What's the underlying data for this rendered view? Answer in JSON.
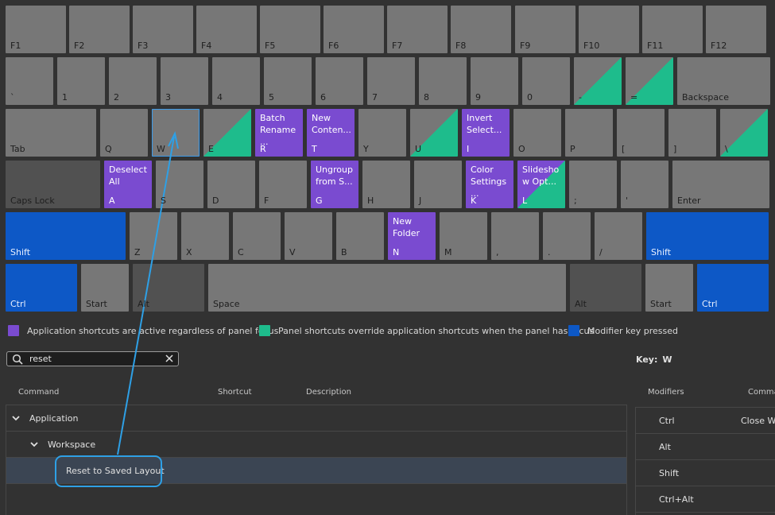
{
  "keyboard": {
    "row1": [
      {
        "key": "F1",
        "cmd": ""
      },
      {
        "key": "F2",
        "cmd": ""
      },
      {
        "key": "F3",
        "cmd": ""
      },
      {
        "key": "F4",
        "cmd": ""
      },
      {
        "key": "F5",
        "cmd": ""
      },
      {
        "key": "F6",
        "cmd": ""
      },
      {
        "key": "F7",
        "cmd": ""
      },
      {
        "key": "F8",
        "cmd": ""
      },
      {
        "key": "F9",
        "cmd": ""
      },
      {
        "key": "F10",
        "cmd": ""
      },
      {
        "key": "F11",
        "cmd": ""
      },
      {
        "key": "F12",
        "cmd": ""
      }
    ],
    "row2": [
      {
        "key": "`"
      },
      {
        "key": "1"
      },
      {
        "key": "2"
      },
      {
        "key": "3"
      },
      {
        "key": "4"
      },
      {
        "key": "5"
      },
      {
        "key": "6"
      },
      {
        "key": "7"
      },
      {
        "key": "8"
      },
      {
        "key": "9"
      },
      {
        "key": "0"
      },
      {
        "key": "-"
      },
      {
        "key": "="
      },
      {
        "key": "Backspace"
      }
    ],
    "row3": [
      {
        "key": "Tab",
        "cmd": ""
      },
      {
        "key": "Q",
        "cmd": ""
      },
      {
        "key": "W",
        "cmd": ""
      },
      {
        "key": "E",
        "cmd": ""
      },
      {
        "key": "R",
        "cmd": "Batch Rename ..."
      },
      {
        "key": "T",
        "cmd": "New Conten..."
      },
      {
        "key": "Y",
        "cmd": ""
      },
      {
        "key": "U",
        "cmd": ""
      },
      {
        "key": "I",
        "cmd": "Invert Select..."
      },
      {
        "key": "O",
        "cmd": ""
      },
      {
        "key": "P",
        "cmd": ""
      },
      {
        "key": "[",
        "cmd": ""
      },
      {
        "key": "]",
        "cmd": ""
      },
      {
        "key": "\\",
        "cmd": ""
      }
    ],
    "row4": [
      {
        "key": "Caps Lock",
        "cmd": ""
      },
      {
        "key": "A",
        "cmd": "Deselect All"
      },
      {
        "key": "S",
        "cmd": ""
      },
      {
        "key": "D",
        "cmd": ""
      },
      {
        "key": "F",
        "cmd": ""
      },
      {
        "key": "G",
        "cmd": "Ungroup from S..."
      },
      {
        "key": "H",
        "cmd": ""
      },
      {
        "key": "J",
        "cmd": ""
      },
      {
        "key": "K",
        "cmd": "Color Settings ..."
      },
      {
        "key": "L",
        "cmd": "Slidesho w Opt..."
      },
      {
        "key": ";",
        "cmd": ""
      },
      {
        "key": "'",
        "cmd": ""
      },
      {
        "key": "Enter",
        "cmd": ""
      }
    ],
    "row5": [
      {
        "key": "Shift",
        "cmd": ""
      },
      {
        "key": "Z",
        "cmd": ""
      },
      {
        "key": "X",
        "cmd": ""
      },
      {
        "key": "C",
        "cmd": ""
      },
      {
        "key": "V",
        "cmd": ""
      },
      {
        "key": "B",
        "cmd": ""
      },
      {
        "key": "N",
        "cmd": "New Folder"
      },
      {
        "key": "M",
        "cmd": ""
      },
      {
        "key": ",",
        "cmd": ""
      },
      {
        "key": ".",
        "cmd": ""
      },
      {
        "key": "/",
        "cmd": ""
      },
      {
        "key": "Shift",
        "cmd": ""
      }
    ],
    "row6": [
      {
        "key": "Ctrl"
      },
      {
        "key": "Start"
      },
      {
        "key": "Alt"
      },
      {
        "key": "Space"
      },
      {
        "key": "Alt"
      },
      {
        "key": "Start"
      },
      {
        "key": "Ctrl"
      }
    ]
  },
  "legend": {
    "application": "Application shortcuts are active regardless of panel focus",
    "panel": "Panel shortcuts override application shortcuts when the panel has focus",
    "modifier": "Modifier key pressed",
    "colors": {
      "application": "#7a4bd0",
      "panel": "#1ebc8c",
      "modifier": "#0d58c6"
    }
  },
  "search": {
    "value": "reset",
    "icon": "search-icon",
    "clear_icon": "close-icon"
  },
  "key_info": {
    "label": "Key:",
    "value": "W"
  },
  "command_table": {
    "headers": {
      "command": "Command",
      "shortcut": "Shortcut",
      "description": "Description"
    },
    "rows": [
      {
        "label": "Application",
        "level": 0,
        "expanded": true
      },
      {
        "label": "Workspace",
        "level": 1,
        "expanded": true
      },
      {
        "label": "Reset to Saved Layout",
        "level": 2,
        "selected": true
      }
    ]
  },
  "modifier_table": {
    "headers": {
      "modifiers": "Modifiers",
      "command": "Comma"
    },
    "rows": [
      {
        "modifier": "Ctrl",
        "command": "Close Wi"
      },
      {
        "modifier": "Alt",
        "command": ""
      },
      {
        "modifier": "Shift",
        "command": ""
      },
      {
        "modifier": "Ctrl+Alt",
        "command": ""
      }
    ]
  }
}
